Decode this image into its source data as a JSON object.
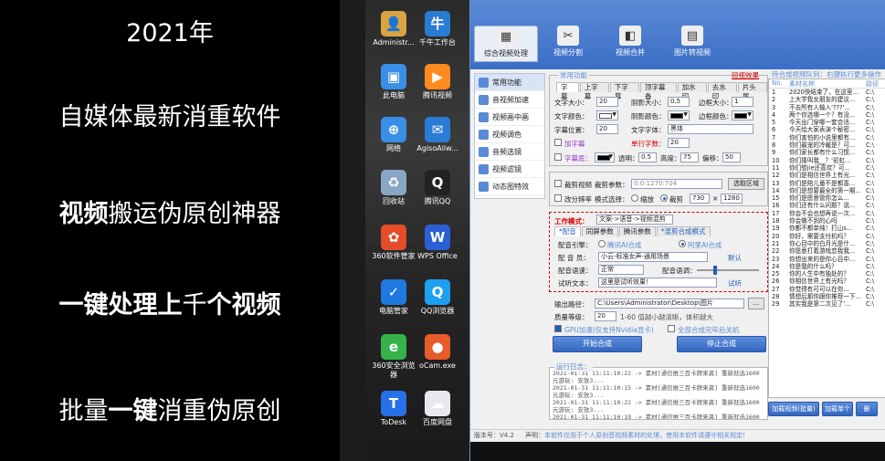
{
  "promo": {
    "year": "2021年",
    "line1": "自媒体最新消重软件",
    "line2_bold": "视频",
    "line2_rest": "搬运伪原创神器",
    "line3_bold": "一键处理上",
    "line3_mid": "千",
    "line3_bold2": "个视频",
    "line4_pre": "批量",
    "line4_bold": "一键",
    "line4_rest": "消重伪原创"
  },
  "desktop_icons": [
    {
      "label": "Administr...",
      "color": "#d9a441",
      "glyph": "👤"
    },
    {
      "label": "千牛工作台",
      "color": "#2a7bd4",
      "glyph": "牛"
    },
    {
      "label": "此电脑",
      "color": "#3a8ee6",
      "glyph": "▣"
    },
    {
      "label": "腾讯视频",
      "color": "#ff8a1f",
      "glyph": "▶"
    },
    {
      "label": "网络",
      "color": "#3a8ee6",
      "glyph": "⊕"
    },
    {
      "label": "AgisoAliw...",
      "color": "#2a7bd4",
      "glyph": "✉"
    },
    {
      "label": "回收站",
      "color": "#8aa6c6",
      "glyph": "♻"
    },
    {
      "label": "腾讯QQ",
      "color": "#222",
      "glyph": "Q"
    },
    {
      "label": "360软件管家",
      "color": "#e44c2a",
      "glyph": "✿"
    },
    {
      "label": "WPS Office",
      "color": "#2a5fd6",
      "glyph": "W"
    },
    {
      "label": "电脑管家",
      "color": "#1f78e0",
      "glyph": "✓"
    },
    {
      "label": "QQ浏览器",
      "color": "#1ea0f0",
      "glyph": "Q"
    },
    {
      "label": "360安全浏览器",
      "color": "#35b34a",
      "glyph": "e"
    },
    {
      "label": "oCam.exe",
      "color": "#e85b2a",
      "glyph": "●"
    },
    {
      "label": "ToDesk",
      "color": "#2670e8",
      "glyph": "T"
    },
    {
      "label": "百度网盘",
      "color": "#e8e8ef",
      "glyph": "☁"
    }
  ],
  "toolbar": [
    {
      "label": "综合视频处理",
      "glyph": "▦"
    },
    {
      "label": "视频分割",
      "glyph": "✂"
    },
    {
      "label": "视频合并",
      "glyph": "◧"
    },
    {
      "label": "图片转视频",
      "glyph": "▤"
    }
  ],
  "sidebar": [
    "常用功能",
    "音视频加速",
    "视频画中画",
    "视频调色",
    "音频选镜",
    "视频滤镜",
    "动态图特效"
  ],
  "common": {
    "title": "常用功能",
    "tips_link": "短视效果",
    "tabs": [
      "字幕",
      "上字幕",
      "下字幕",
      "顶字幕备",
      "加水印",
      "去水印",
      "片头尾"
    ],
    "font_size_label": "文字大小：",
    "font_size": "20",
    "shadow_size_label": "阴影大小：",
    "shadow_size": "0.5",
    "border_size_label": "边框大小：",
    "border_size": "1",
    "font_color_label": "文字颜色：",
    "shadow_color_label": "阴影颜色：",
    "border_color_label": "边框颜色：",
    "font_pos_label": "字幕位置：",
    "font_pos": "20",
    "font_family_label": "文字字体：",
    "font_family": "黑体",
    "add_title_label": "加字幕",
    "single_char_label": "单行字数：",
    "single_char": "20",
    "subtitle_bg_label": "字幕底：",
    "transparency_label": "透明：",
    "transparency": "0.5",
    "height_label": "高度：",
    "height": "75",
    "offset_label": "偏移：",
    "offset": "50",
    "crop_label": "裁剪视频",
    "crop_param_label": "裁剪参数：",
    "crop_param": "0:0:1270:704",
    "select_area": "选取区域",
    "resize_label": "改分辨率",
    "mode_label": "模式选择：",
    "mode_scale": "缩放",
    "mode_crop": "裁剪",
    "res_w": "730",
    "res_x": "×",
    "res_h": "1280"
  },
  "work": {
    "title": "工作模式：",
    "mode": "文案->语音->视频混剪",
    "tabs": [
      "*配音",
      "同屏参数",
      "腾讯参数",
      "*混剪合成模式"
    ],
    "engine_label": "配音引擎：",
    "engine_opt1": "腾讯AI合成",
    "engine_opt2": "阿里AI合成",
    "voice_label": "配 音 员：",
    "voice": "小云-标准女声-通用场景",
    "default_btn": "默认",
    "speed_label": "配音语速：",
    "speed": "正常",
    "tone_label": "配音语调：",
    "test_label": "试听文本：",
    "test_text": "这里是试听效果！",
    "test_btn": "试听"
  },
  "output": {
    "path_label": "输出路径：",
    "path": "C:\\Users\\Administrator\\Desktop\\图片",
    "browse": "...",
    "quality_label": "质量等级：",
    "quality": "20",
    "quality_hint": "1-60 值越小越清晰，体积越大",
    "gpu_label": "GPU加速(仅支持Nvidia显卡)",
    "shutdown_label": "全部合成完毕后关机",
    "start_btn": "开始合成",
    "stop_btn": "停止合成"
  },
  "log": {
    "title": "运行日志：",
    "lines": [
      "2021-01-31 11:11:10:22 -> 素材[通信推三百卡牌来袭] 重新就选1600元游玩: 安放3...",
      "2021-01-31 11:11:10:15 -> 素材[通信推三百卡牌来袭] 重新就选1600元游玩: 安放3...",
      "2021-01-31 11:11:10:22 -> 素材[通信推三百卡牌来袭] 重新就选1600元游玩: 安放3...",
      "2021-01-31 11:11:10:19 -> 素材[通信推三百卡牌来袭] 重新就选1600元游玩: 合成中...",
      "2021-01-31 11:11:10:15 -> 素材[通信推三百卡牌来袭] 重新就选1600元游玩: 合成完毕..."
    ]
  },
  "queue": {
    "title": "待合成视频队列：右键执行更多操作",
    "col_no": "No.",
    "col_file": "素材名称",
    "col_path": "路径",
    "rows": [
      [
        "1",
        "2020快结束了，在这里...",
        "C:\\"
      ],
      [
        "2",
        "上大学我女朋友的建议...",
        "C:\\"
      ],
      [
        "3",
        "不去所有人输入'???'...",
        "C:\\"
      ],
      [
        "4",
        "两个你选哪一个？有没...",
        "C:\\"
      ],
      [
        "5",
        "今天出门穿哪一套合适...",
        "C:\\"
      ],
      [
        "6",
        "今天给大家表演个秘密...",
        "C:\\"
      ],
      [
        "7",
        "你们害怕的小说里都有...",
        "C:\\"
      ],
      [
        "8",
        "你们最宠的冷暖是？可...",
        "C:\\"
      ],
      [
        "9",
        "你们家长都有什么习惯...",
        "C:\\"
      ],
      [
        "10",
        "你们猜叫我__？'彩虹...",
        "C:\\"
      ],
      [
        "11",
        "你们想jie还喜欢？可...",
        "C:\\"
      ],
      [
        "12",
        "你们是相信世界上有光...",
        "C:\\"
      ],
      [
        "13",
        "你们是陪儿童不是都喜...",
        "C:\\"
      ],
      [
        "14",
        "你们是想要最全的第一期...",
        "C:\\"
      ],
      [
        "15",
        "你们是愿意管你怎么...",
        "C:\\"
      ],
      [
        "16",
        "你们还有什么问题？说...",
        "C:\\"
      ],
      [
        "17",
        "你会不会也想再说一次...",
        "C:\\"
      ],
      [
        "18",
        "你会做不到的心吗",
        "C:\\"
      ],
      [
        "19",
        "你都不都单纯！打山s...",
        "C:\\"
      ],
      [
        "20",
        "你好，需要支付机吗？",
        "C:\\"
      ],
      [
        "21",
        "你心目中的白月光是什...",
        "C:\\"
      ],
      [
        "22",
        "你愿意打着游戏恋我我...",
        "C:\\"
      ],
      [
        "23",
        "你想出来的是你心目中...",
        "C:\\"
      ],
      [
        "24",
        "你是我的什么吗？",
        "C:\\"
      ],
      [
        "25",
        "你的人生中有独处的？",
        "C:\\"
      ],
      [
        "26",
        "你相信世界上有光吗？",
        "C:\\"
      ],
      [
        "27",
        "你觉得有可可以在你...",
        "C:\\"
      ],
      [
        "28",
        "情想后那你跟你推荐一下...",
        "C:\\"
      ],
      [
        "29",
        "其实我是第二次见了'...",
        "C:\\"
      ]
    ],
    "btn_add": "加载视频(批量)",
    "btn_add_one": "加载单个",
    "btn_more": "删"
  },
  "status": {
    "version": "版本号：V4.2",
    "notice_label": "声明：",
    "notice": "本软件仅用于个人原创音视频素材的处理，使用本软件请遵守相关规定!"
  }
}
